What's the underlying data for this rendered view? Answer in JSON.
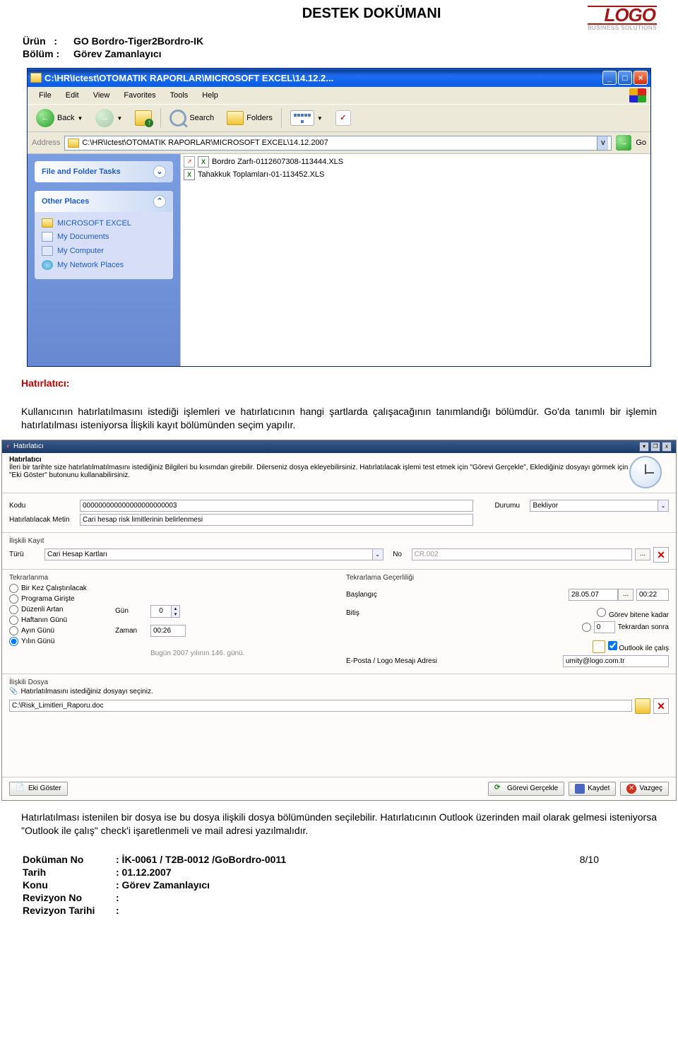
{
  "doc": {
    "title": "DESTEK DOKÜMANI",
    "logo": "LOGO",
    "logo_sub": "BUSINESS SOLUTIONS",
    "urun_label": "Ürün",
    "urun_value": "GO Bordro-Tiger2Bordro-IK",
    "bolum_label": "Bölüm",
    "bolum_value": "Görev Zamanlayıcı"
  },
  "explorer": {
    "title": "C:\\HR\\Ictest\\OTOMATIK RAPORLAR\\MICROSOFT EXCEL\\14.12.2...",
    "menu": {
      "file": "File",
      "edit": "Edit",
      "view": "View",
      "favorites": "Favorites",
      "tools": "Tools",
      "help": "Help"
    },
    "toolbar": {
      "back": "Back",
      "search": "Search",
      "folders": "Folders"
    },
    "address_label": "Address",
    "address": "C:\\HR\\Ictest\\OTOMATIK RAPORLAR\\MICROSOFT EXCEL\\14.12.2007",
    "go": "Go",
    "panel1": "File and Folder Tasks",
    "panel2": "Other Places",
    "places": {
      "excel": "MICROSOFT EXCEL",
      "docs": "My Documents",
      "comp": "My Computer",
      "net": "My Network Places"
    },
    "files": {
      "f1": "Bordro Zarfı-0112607308-113444.XLS",
      "f2": "Tahakkuk Toplamları-01-113452.XLS"
    }
  },
  "para1": {
    "label": "Hatırlatıcı:",
    "text": "Kullanıcının hatırlatılmasını istediği işlemleri ve hatırlatıcının hangi şartlarda çalışacağının tanımlandığı bölümdür. Go'da tanımlı bir işlemin hatırlatılması isteniyorsa İlişkili kayıt bölümünden seçim yapılır."
  },
  "form": {
    "title": "Hatırlatıcı",
    "heading": "Hatırlatıcı",
    "desc": "İleri bir tarihte size hatırlatılmatılmasını istediğiniz Bilgileri bu kısımdan girebilir. Dilerseniz dosya ekleyebilirsiniz. Hatırlatılacak işlemi test etmek için \"Görevi Gerçekle\", Eklediğiniz dosyayı görmek için \"Eki Göster\" butonunu kullanabilirsiniz.",
    "kodu_l": "Kodu",
    "kodu_v": "000000000000000000000003",
    "durumu_l": "Durumu",
    "durumu_v": "Bekliyor",
    "metin_l": "Hatırlatılacak Metin",
    "metin_v": "Cari hesap risk limitlerinin belirlenmesi",
    "iliskili": "İlişkili Kayıt",
    "turu_l": "Türü",
    "turu_v": "Cari Hesap Kartları",
    "no_l": "No",
    "no_v": "CR.002",
    "tekrar": "Tekrarlanma",
    "r1": "Bir Kez Çalıştırılacak",
    "r2": "Programa Girişte",
    "r3": "Düzenli Artan",
    "r4": "Haftanın Günü",
    "r5": "Ayın Günü",
    "r6": "Yılın Günü",
    "gun_l": "Gün",
    "gun_v": "0",
    "zaman_l": "Zaman",
    "zaman_v": "00:26",
    "bugun": "Bugün 2007 yılının 146. günü.",
    "gecer": "Tekrarlama Geçerliliği",
    "bas_l": "Başlangıç",
    "bas_d": "28.05.07",
    "bas_t": "00:22",
    "bit_l": "Bitiş",
    "bit_r1": "Görev bitene kadar",
    "bit_n": "0",
    "bit_r2": "Tekrardan sonra",
    "outlook_chk": "Outlook ile çalış",
    "eposta_l": "E-Posta / Logo Mesajı Adresi",
    "eposta_v": "umity@logo.com.tr",
    "dosya_grp": "İlişkili Dosya",
    "dosya_hint": "Hatırlatılmasını istediğiniz dosyayı seçiniz.",
    "dosya_v": "C:\\Risk_Limitleri_Raporu.doc",
    "btn_eki": "Eki Göster",
    "btn_gercek": "Görevi Gerçekle",
    "btn_kaydet": "Kaydet",
    "btn_vazgec": "Vazgeç"
  },
  "para2": "Hatırlatılması istenilen bir dosya ise bu dosya ilişkili dosya bölümünden seçilebilir. Hatırlatıcının Outlook üzerinden mail olarak gelmesi isteniyorsa \"Outlook ile çalış\" check'i işaretlenmeli ve mail adresi yazılmalıdır.",
  "footer": {
    "dokno_l": "Doküman No",
    "dokno_v": ": İK-0061 / T2B-0012 /GoBordro-0011",
    "tarih_l": "Tarih",
    "tarih_v": ": 01.12.2007",
    "konu_l": "Konu",
    "konu_v": ": Görev Zamanlayıcı",
    "revno_l": "Revizyon No",
    "revno_v": ":",
    "revt_l": "Revizyon Tarihi",
    "revt_v": ":",
    "page": "8/10"
  }
}
